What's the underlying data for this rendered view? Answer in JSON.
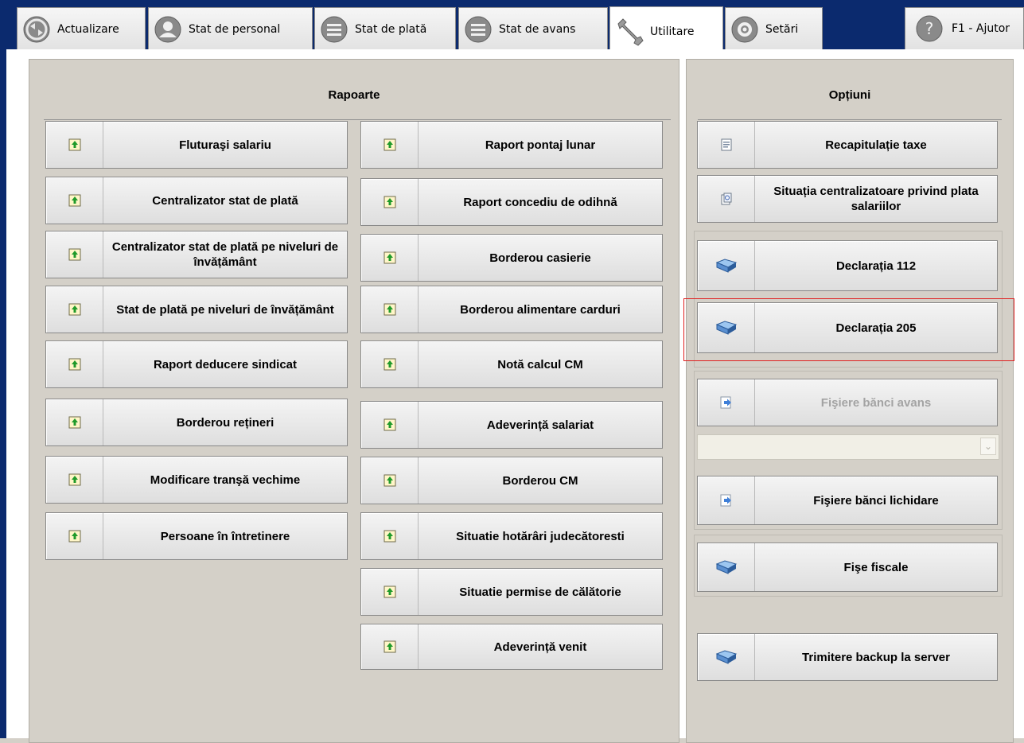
{
  "tabs": [
    {
      "label": "Actualizare",
      "icon": "refresh-icon"
    },
    {
      "label": "Stat de personal",
      "icon": "person-icon"
    },
    {
      "label": "Stat de plată",
      "icon": "list-icon"
    },
    {
      "label": "Stat de avans",
      "icon": "list-icon"
    },
    {
      "label": "Utilitare",
      "icon": "wrench-icon",
      "active": true
    },
    {
      "label": "Setări",
      "icon": "gear-icon"
    }
  ],
  "help": {
    "label": "F1 - Ajutor",
    "icon": "help-icon"
  },
  "rapoarte": {
    "title": "Rapoarte",
    "col1": [
      "Fluturaşi salariu",
      "Centralizator stat de plată",
      "Centralizator stat de plată pe niveluri de învățământ",
      "Stat de plată pe niveluri de învățământ",
      "Raport deducere sindicat",
      "Borderou rețineri",
      "Modificare tranşă vechime",
      "Persoane în întretinere"
    ],
    "col2": [
      "Raport pontaj lunar",
      "Raport concediu de odihnă",
      "Borderou casierie",
      "Borderou alimentare carduri",
      "Notă calcul CM",
      "Adeverință salariat",
      "Borderou CM",
      "Situatie hotărâri judecătoresti",
      "Situatie permise de călătorie",
      "Adeverință venit"
    ]
  },
  "optiuni": {
    "title": "Opțiuni",
    "recapitulatie": "Recapitulație taxe",
    "situatia": "Situația centralizatoare privind plata salariilor",
    "declaratia112": "Declarația 112",
    "declaratia205": "Declarația 205",
    "fisiere_avans": "Fişiere bănci avans",
    "fisiere_lichidare": "Fişiere bănci lichidare",
    "fise_fiscale": "Fişe fiscale",
    "backup": "Trimitere backup la server",
    "combo_value": ""
  },
  "colors": {
    "accent_border": "#e02020",
    "frame": "#0b2a6e"
  }
}
